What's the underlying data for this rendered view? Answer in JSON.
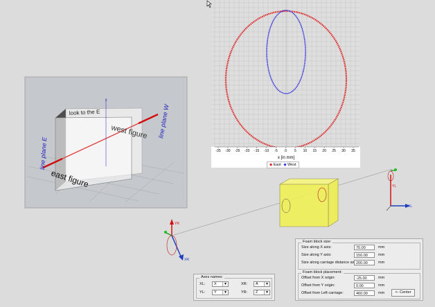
{
  "plot": {
    "xlabel": "x [in mm]",
    "ticks": [
      "-35",
      "-30",
      "-25",
      "-20",
      "-15",
      "-10",
      "-5",
      "0",
      "5",
      "10",
      "15",
      "20",
      "25",
      "30",
      "35"
    ],
    "legend": {
      "east": "East",
      "west": "West"
    },
    "colors": {
      "east": "#e02020",
      "west": "#3030e0"
    }
  },
  "preview": {
    "line_plane_east": "line plane E",
    "line_plane_west": "line plane W",
    "east_figure": "east figure",
    "west_figure": "west figure",
    "block_top_text": "look to the E",
    "axis_z": "z"
  },
  "axes3d": {
    "xl": "XL",
    "yl": "YL",
    "xr": "XR",
    "yr": "YR"
  },
  "foam_size": {
    "title": "Foam block size:",
    "x_label": "Size along X axis:",
    "x_value": "70.00",
    "y_label": "Size along Y axis:",
    "y_value": "150.00",
    "dist_label": "Size along carriage distance axis:",
    "dist_value": "200.00",
    "unit": "mm"
  },
  "foam_place": {
    "title": "Foam block placement:",
    "x_label": "Offset from X origin:",
    "x_value": "-25.00",
    "y_label": "Offset from Y origin:",
    "y_value": "0.00",
    "left_label": "Offset from Left carriage:",
    "left_value": "460.00",
    "unit": "mm",
    "center_btn": "<- Center"
  },
  "axes_names": {
    "title": "Axes names:",
    "xl_label": "XL:",
    "xl_value": "X",
    "xr_label": "XR:",
    "xr_value": "A",
    "yl_label": "YL:",
    "yl_value": "Y",
    "yr_label": "YR:",
    "yr_value": "Z"
  }
}
